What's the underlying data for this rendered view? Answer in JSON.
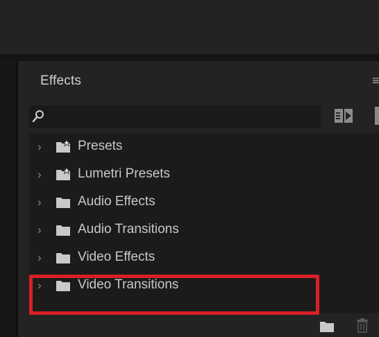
{
  "panel": {
    "title": "Effects",
    "menu_icon": "panel-menu-icon"
  },
  "search": {
    "value": "",
    "placeholder": "",
    "icon": "search-icon"
  },
  "toolbar": {
    "new_bin_icon": "accelerated-effects-icon"
  },
  "tree": [
    {
      "label": "Presets",
      "icon": "star-folder-icon",
      "expanded": false,
      "highlighted": false
    },
    {
      "label": "Lumetri Presets",
      "icon": "star-folder-icon",
      "expanded": false,
      "highlighted": false
    },
    {
      "label": "Audio Effects",
      "icon": "folder-icon",
      "expanded": false,
      "highlighted": false
    },
    {
      "label": "Audio Transitions",
      "icon": "folder-icon",
      "expanded": false,
      "highlighted": false
    },
    {
      "label": "Video Effects",
      "icon": "folder-icon",
      "expanded": false,
      "highlighted": false
    },
    {
      "label": "Video Transitions",
      "icon": "folder-icon",
      "expanded": false,
      "highlighted": true
    }
  ],
  "footer": {
    "new_folder_icon": "folder-icon",
    "delete_icon": "trash-icon"
  },
  "colors": {
    "highlight_border": "#d91f26",
    "panel_bg": "#232323",
    "list_bg": "#1b1b1b"
  }
}
